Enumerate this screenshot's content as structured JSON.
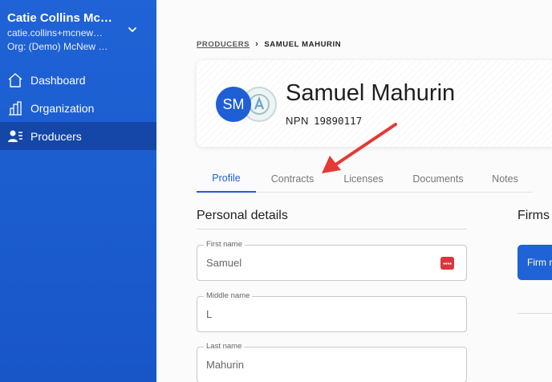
{
  "user": {
    "name": "Catie Collins Mc…",
    "email": "catie.collins+mcnew…",
    "org": "Org: (Demo) McNew …"
  },
  "nav": [
    {
      "label": "Dashboard",
      "icon": "home-icon"
    },
    {
      "label": "Organization",
      "icon": "building-icon"
    },
    {
      "label": "Producers",
      "icon": "users-icon",
      "active": true
    }
  ],
  "breadcrumb": {
    "parent": "PRODUCERS",
    "current": "SAMUEL MAHURIN"
  },
  "producer": {
    "initials": "SM",
    "name": "Samuel Mahurin",
    "npn_label": "NPN",
    "npn": "19890117"
  },
  "tabs": [
    "Profile",
    "Contracts",
    "Licenses",
    "Documents",
    "Notes"
  ],
  "active_tab": "Profile",
  "personal_details": {
    "title": "Personal details",
    "fields": [
      {
        "label": "First name",
        "value": "Samuel"
      },
      {
        "label": "Middle name",
        "value": "L"
      },
      {
        "label": "Last name",
        "value": "Mahurin"
      }
    ]
  },
  "firms": {
    "title": "Firms",
    "button_label": "Firm n"
  },
  "colors": {
    "sidebar": "#1f63d6",
    "accent": "#1f5fd6",
    "arrow": "#e53935"
  }
}
